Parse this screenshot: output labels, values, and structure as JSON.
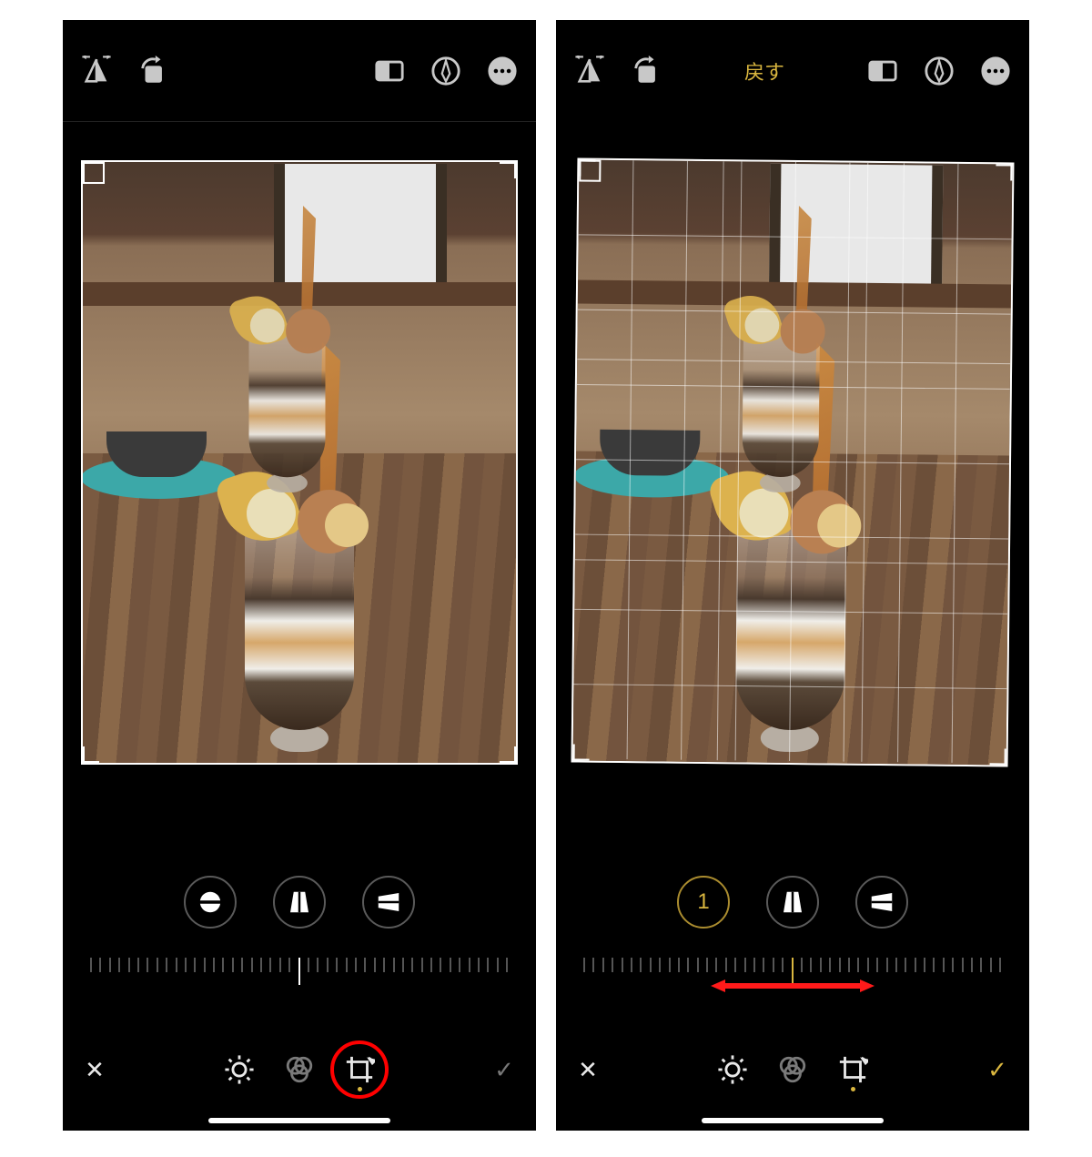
{
  "left": {
    "top": {
      "flip_h_icon": "flip-horizontal-icon",
      "rotate_icon": "rotate-ccw-icon",
      "undo_label": "",
      "aspect_icon": "aspect-ratio-icon",
      "markup_icon": "markup-pen-icon",
      "more_icon": "more-ellipsis-icon"
    },
    "adjust": {
      "straighten_icon": "straighten-icon",
      "vertical_perspective_icon": "perspective-vertical-icon",
      "horizontal_perspective_icon": "perspective-horizontal-icon"
    },
    "ruler_center_value": "",
    "modes": {
      "adjust_icon": "light-adjust-icon",
      "filters_icon": "filters-icon",
      "crop_icon": "crop-rotate-icon"
    },
    "cancel": "✕",
    "done": "✓",
    "annotation": {
      "red_ring_on_crop": true
    }
  },
  "right": {
    "top": {
      "flip_h_icon": "flip-horizontal-icon",
      "rotate_icon": "rotate-ccw-icon",
      "undo_label": "戻す",
      "aspect_icon": "aspect-ratio-icon",
      "markup_icon": "markup-pen-icon",
      "more_icon": "more-ellipsis-icon"
    },
    "adjust": {
      "straighten_value": "1",
      "vertical_perspective_icon": "perspective-vertical-icon",
      "horizontal_perspective_icon": "perspective-horizontal-icon"
    },
    "grid_visible": true,
    "modes": {
      "adjust_icon": "light-adjust-icon",
      "filters_icon": "filters-icon",
      "crop_icon": "crop-rotate-icon"
    },
    "cancel": "✕",
    "done": "✓",
    "annotation": {
      "slider_red_arrow": true
    }
  },
  "colors": {
    "accent": "#d9b63f",
    "annotation_red": "#ff0000"
  }
}
